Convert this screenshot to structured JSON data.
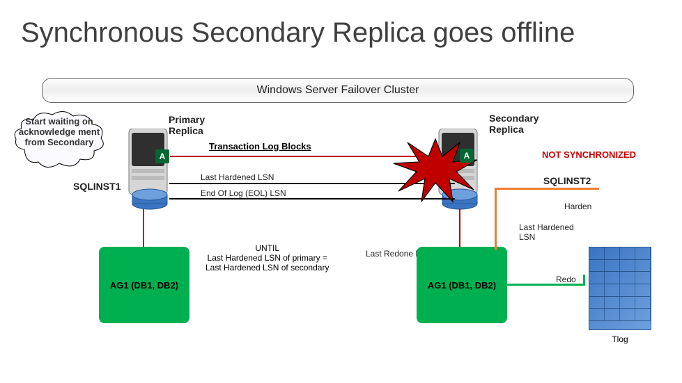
{
  "title": "Synchronous Secondary Replica goes offline",
  "cluster": "Windows Server Failover Cluster",
  "cloud": "Start waiting on acknowledge ment from Secondary",
  "primary": {
    "label": "Primary\nReplica",
    "badge": "A",
    "inst": "SQLINST1",
    "ag": "AG1 (DB1, DB2)"
  },
  "secondary": {
    "label": "Secondary\nReplica",
    "badge": "A",
    "inst": "SQLINST2",
    "ag": "AG1 (DB1, DB2)"
  },
  "txlog": "Transaction Log Blocks",
  "status": "NOT SYNCHRONIZED",
  "lines": {
    "lastHardenedLSN": "Last Hardened LSN",
    "eol": "End Of Log (EOL) LSN",
    "lastRedone": "Last Redone LSN",
    "lastRedoneShort": "Last Redone LSN",
    "harden": "Harden",
    "redo": "Redo",
    "lastHardenedShort": "Last Hardened\nLSN"
  },
  "untilText": "UNTIL\nLast Hardened LSN of primary =\nLast Hardened LSN of secondary",
  "tlog": "Tlog"
}
